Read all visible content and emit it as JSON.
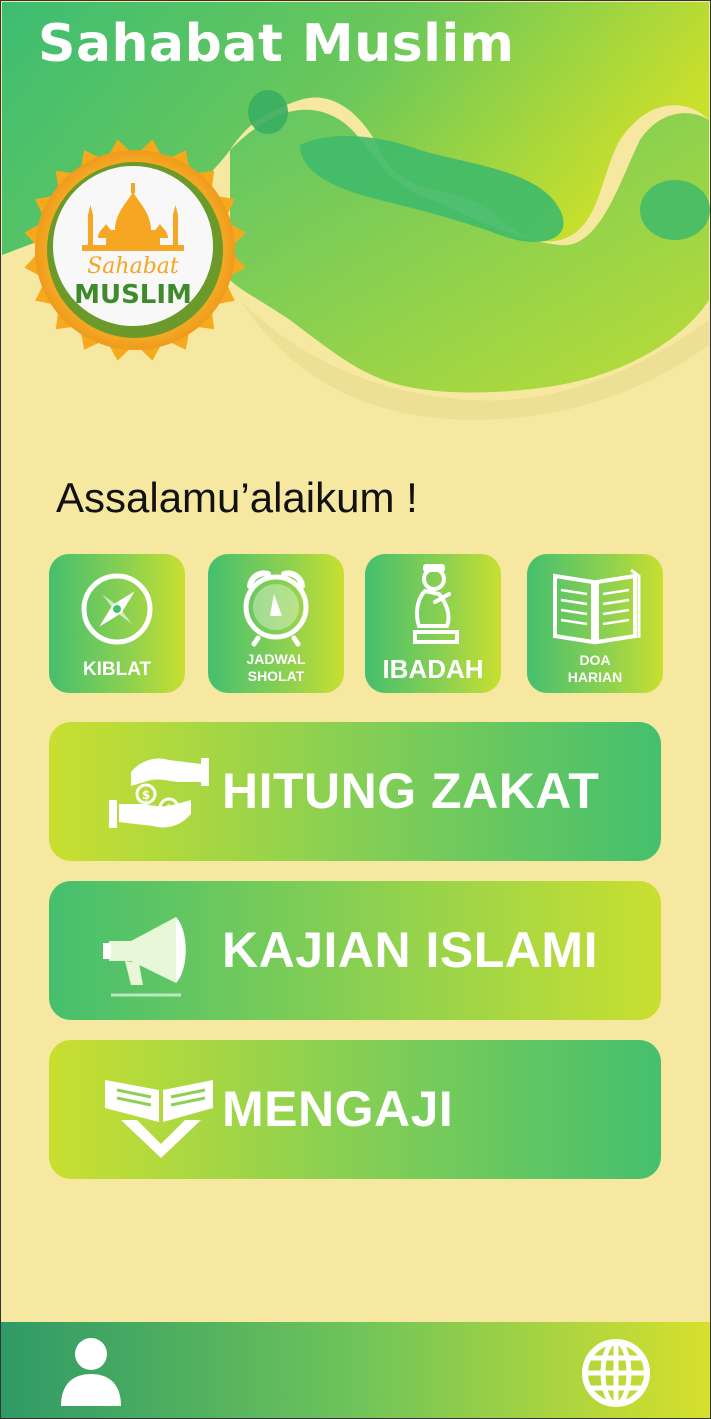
{
  "app": {
    "title": "Sahabat Muslim"
  },
  "logo": {
    "line1": "Sahabat",
    "line2": "MUSLIM"
  },
  "greeting": "Assalamu’alaikum !",
  "tiles": [
    {
      "lines": [
        "KIBLAT"
      ],
      "icon": "compass-icon"
    },
    {
      "lines": [
        "JADWAL",
        "SHOLAT"
      ],
      "icon": "alarm-clock-icon"
    },
    {
      "lines": [
        "IBADAH"
      ],
      "icon": "praying-person-icon"
    },
    {
      "lines": [
        "DOA",
        "HARIAN"
      ],
      "icon": "open-book-icon"
    }
  ],
  "buttons": {
    "zakat": {
      "label": "HITUNG ZAKAT",
      "icon": "hands-coins-icon"
    },
    "kajian": {
      "label": "KAJIAN ISLAMI",
      "icon": "megaphone-icon"
    },
    "mengaji": {
      "label": "MENGAJI",
      "icon": "quran-stand-icon"
    }
  },
  "nav": {
    "left_icon": "user-icon",
    "right_icon": "globe-icon"
  },
  "colors": {
    "background": "#f6e8a0",
    "green": "#45bf6e",
    "lime": "#c9df30",
    "gold": "#f5a623"
  }
}
